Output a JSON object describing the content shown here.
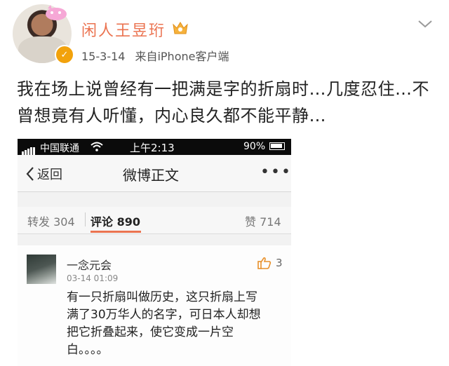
{
  "post": {
    "username": "闲人王昱珩",
    "date": "15-3-14",
    "source": "来自iPhone客户端",
    "text": "我在场上说曾经有一把满是字的折扇时…几度忍住…不曾想竟有人听懂，内心良久都不能平静…",
    "accent_color": "#eb7350"
  },
  "screenshot": {
    "status_bar": {
      "carrier": "中国联通",
      "time": "上午2:13",
      "battery": "90%"
    },
    "navbar": {
      "back_label": "返回",
      "title": "微博正文",
      "more": "•••"
    },
    "stats": {
      "forward": "转发 304",
      "comment_label": "评论",
      "comment_count": "890",
      "like": "赞 714"
    },
    "comment": {
      "author": "一念元会",
      "date": "03-14 01:09",
      "likes": "3",
      "text": "有一只折扇叫做历史，这只折扇上写满了30万华人的名字，可日本人却想把它折叠起来，使它变成一片空白。。。。"
    }
  },
  "icons": {
    "verified": "verified-badge-icon",
    "crown": "vip-crown-icon",
    "chevron": "chevron-down-icon",
    "like": "thumbs-up-icon"
  }
}
